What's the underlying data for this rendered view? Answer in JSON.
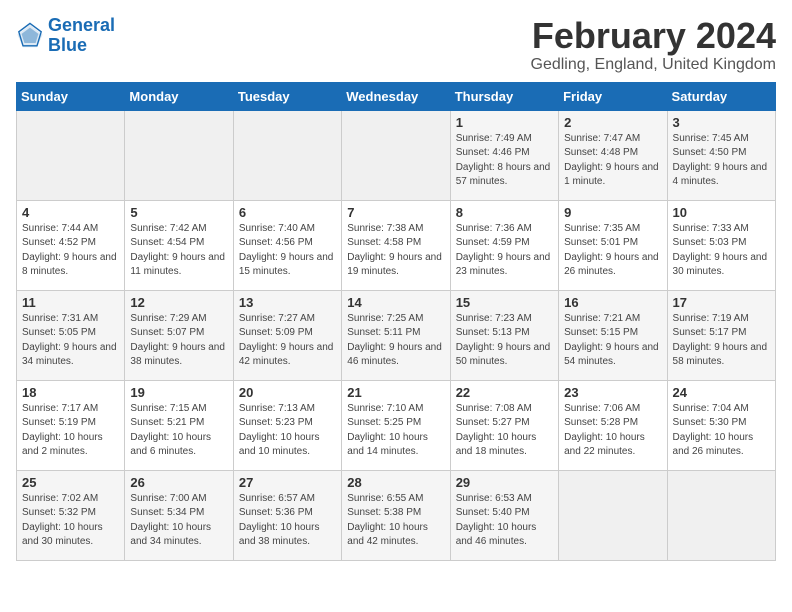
{
  "header": {
    "logo_line1": "General",
    "logo_line2": "Blue",
    "month_title": "February 2024",
    "location": "Gedling, England, United Kingdom"
  },
  "days_of_week": [
    "Sunday",
    "Monday",
    "Tuesday",
    "Wednesday",
    "Thursday",
    "Friday",
    "Saturday"
  ],
  "weeks": [
    [
      {
        "day": "",
        "empty": true
      },
      {
        "day": "",
        "empty": true
      },
      {
        "day": "",
        "empty": true
      },
      {
        "day": "",
        "empty": true
      },
      {
        "day": "1",
        "sunrise": "7:49 AM",
        "sunset": "4:46 PM",
        "daylight": "8 hours and 57 minutes."
      },
      {
        "day": "2",
        "sunrise": "7:47 AM",
        "sunset": "4:48 PM",
        "daylight": "9 hours and 1 minute."
      },
      {
        "day": "3",
        "sunrise": "7:45 AM",
        "sunset": "4:50 PM",
        "daylight": "9 hours and 4 minutes."
      }
    ],
    [
      {
        "day": "4",
        "sunrise": "7:44 AM",
        "sunset": "4:52 PM",
        "daylight": "9 hours and 8 minutes."
      },
      {
        "day": "5",
        "sunrise": "7:42 AM",
        "sunset": "4:54 PM",
        "daylight": "9 hours and 11 minutes."
      },
      {
        "day": "6",
        "sunrise": "7:40 AM",
        "sunset": "4:56 PM",
        "daylight": "9 hours and 15 minutes."
      },
      {
        "day": "7",
        "sunrise": "7:38 AM",
        "sunset": "4:58 PM",
        "daylight": "9 hours and 19 minutes."
      },
      {
        "day": "8",
        "sunrise": "7:36 AM",
        "sunset": "4:59 PM",
        "daylight": "9 hours and 23 minutes."
      },
      {
        "day": "9",
        "sunrise": "7:35 AM",
        "sunset": "5:01 PM",
        "daylight": "9 hours and 26 minutes."
      },
      {
        "day": "10",
        "sunrise": "7:33 AM",
        "sunset": "5:03 PM",
        "daylight": "9 hours and 30 minutes."
      }
    ],
    [
      {
        "day": "11",
        "sunrise": "7:31 AM",
        "sunset": "5:05 PM",
        "daylight": "9 hours and 34 minutes."
      },
      {
        "day": "12",
        "sunrise": "7:29 AM",
        "sunset": "5:07 PM",
        "daylight": "9 hours and 38 minutes."
      },
      {
        "day": "13",
        "sunrise": "7:27 AM",
        "sunset": "5:09 PM",
        "daylight": "9 hours and 42 minutes."
      },
      {
        "day": "14",
        "sunrise": "7:25 AM",
        "sunset": "5:11 PM",
        "daylight": "9 hours and 46 minutes."
      },
      {
        "day": "15",
        "sunrise": "7:23 AM",
        "sunset": "5:13 PM",
        "daylight": "9 hours and 50 minutes."
      },
      {
        "day": "16",
        "sunrise": "7:21 AM",
        "sunset": "5:15 PM",
        "daylight": "9 hours and 54 minutes."
      },
      {
        "day": "17",
        "sunrise": "7:19 AM",
        "sunset": "5:17 PM",
        "daylight": "9 hours and 58 minutes."
      }
    ],
    [
      {
        "day": "18",
        "sunrise": "7:17 AM",
        "sunset": "5:19 PM",
        "daylight": "10 hours and 2 minutes."
      },
      {
        "day": "19",
        "sunrise": "7:15 AM",
        "sunset": "5:21 PM",
        "daylight": "10 hours and 6 minutes."
      },
      {
        "day": "20",
        "sunrise": "7:13 AM",
        "sunset": "5:23 PM",
        "daylight": "10 hours and 10 minutes."
      },
      {
        "day": "21",
        "sunrise": "7:10 AM",
        "sunset": "5:25 PM",
        "daylight": "10 hours and 14 minutes."
      },
      {
        "day": "22",
        "sunrise": "7:08 AM",
        "sunset": "5:27 PM",
        "daylight": "10 hours and 18 minutes."
      },
      {
        "day": "23",
        "sunrise": "7:06 AM",
        "sunset": "5:28 PM",
        "daylight": "10 hours and 22 minutes."
      },
      {
        "day": "24",
        "sunrise": "7:04 AM",
        "sunset": "5:30 PM",
        "daylight": "10 hours and 26 minutes."
      }
    ],
    [
      {
        "day": "25",
        "sunrise": "7:02 AM",
        "sunset": "5:32 PM",
        "daylight": "10 hours and 30 minutes."
      },
      {
        "day": "26",
        "sunrise": "7:00 AM",
        "sunset": "5:34 PM",
        "daylight": "10 hours and 34 minutes."
      },
      {
        "day": "27",
        "sunrise": "6:57 AM",
        "sunset": "5:36 PM",
        "daylight": "10 hours and 38 minutes."
      },
      {
        "day": "28",
        "sunrise": "6:55 AM",
        "sunset": "5:38 PM",
        "daylight": "10 hours and 42 minutes."
      },
      {
        "day": "29",
        "sunrise": "6:53 AM",
        "sunset": "5:40 PM",
        "daylight": "10 hours and 46 minutes."
      },
      {
        "day": "",
        "empty": true
      },
      {
        "day": "",
        "empty": true
      }
    ]
  ]
}
